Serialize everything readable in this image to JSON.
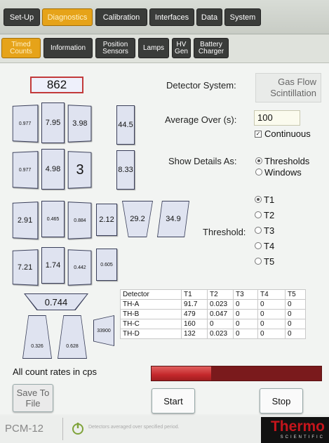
{
  "top_tabs": [
    {
      "label": "Set-Up",
      "active": false
    },
    {
      "label": "Diagnostics",
      "active": true
    },
    {
      "label": "Calibration",
      "active": false
    },
    {
      "label": "Interfaces",
      "active": false
    },
    {
      "label": "Data",
      "active": false
    },
    {
      "label": "System",
      "active": false
    }
  ],
  "sub_tabs": [
    {
      "line1": "Timed",
      "line2": "Counts",
      "active": true
    },
    {
      "line1": "Information",
      "line2": "",
      "active": false
    },
    {
      "line1": "Position",
      "line2": "Sensors",
      "active": false
    },
    {
      "line1": "Lamps",
      "line2": "",
      "active": false
    },
    {
      "line1": "HV",
      "line2": "Gen",
      "active": false
    },
    {
      "line1": "Battery",
      "line2": "Charger",
      "active": false
    }
  ],
  "total_count": "862",
  "detector_cells": [
    "0.977",
    "7.95",
    "3.98",
    "44.5",
    "0.977",
    "4.98",
    "3",
    "8.33",
    "2.91",
    "0.465",
    "0.884",
    "2.12",
    "29.2",
    "34.9",
    "7.21",
    "1.74",
    "0.442",
    "0.605",
    "0.744",
    "0.326",
    "0.628",
    "33900"
  ],
  "settings": {
    "detector_system_label": "Detector System:",
    "detector_system_value_line1": "Gas Flow",
    "detector_system_value_line2": "Scintillation",
    "average_over_label": "Average Over (s):",
    "average_over_value": "100",
    "continuous_label": "Continuous",
    "continuous_checked": true,
    "show_details_label": "Show Details As:",
    "show_details_options": [
      "Thresholds",
      "Windows"
    ],
    "show_details_selected": "Thresholds",
    "threshold_label": "Threshold:",
    "threshold_options": [
      "T1",
      "T2",
      "T3",
      "T4",
      "T5"
    ],
    "threshold_selected": "T1"
  },
  "table": {
    "headers": [
      "Detector",
      "T1",
      "T2",
      "T3",
      "T4",
      "T5"
    ],
    "rows": [
      [
        "TH-A",
        "91.7",
        "0.023",
        "0",
        "0",
        "0"
      ],
      [
        "TH-B",
        "479",
        "0.047",
        "0",
        "0",
        "0"
      ],
      [
        "TH-C",
        "160",
        "0",
        "0",
        "0",
        "0"
      ],
      [
        "TH-D",
        "132",
        "0.023",
        "0",
        "0",
        "0"
      ]
    ]
  },
  "count_rate_note": "All count rates in cps",
  "progress_fraction": 0.35,
  "buttons": {
    "save_line1": "Save To",
    "save_line2": "File",
    "start": "Start",
    "stop": "Stop"
  },
  "footer": {
    "model": "PCM-12",
    "status": "Detectors averaged over specified period.",
    "brand": "Thermo",
    "brand_sub": "SCIENTIFIC"
  },
  "colors": {
    "active_tab": "#e6a319",
    "inactive_tab": "#3a3c3a",
    "progress_fill": "#c4282b",
    "progress_track": "#7a1a1c",
    "brand_red": "#c4151c"
  }
}
